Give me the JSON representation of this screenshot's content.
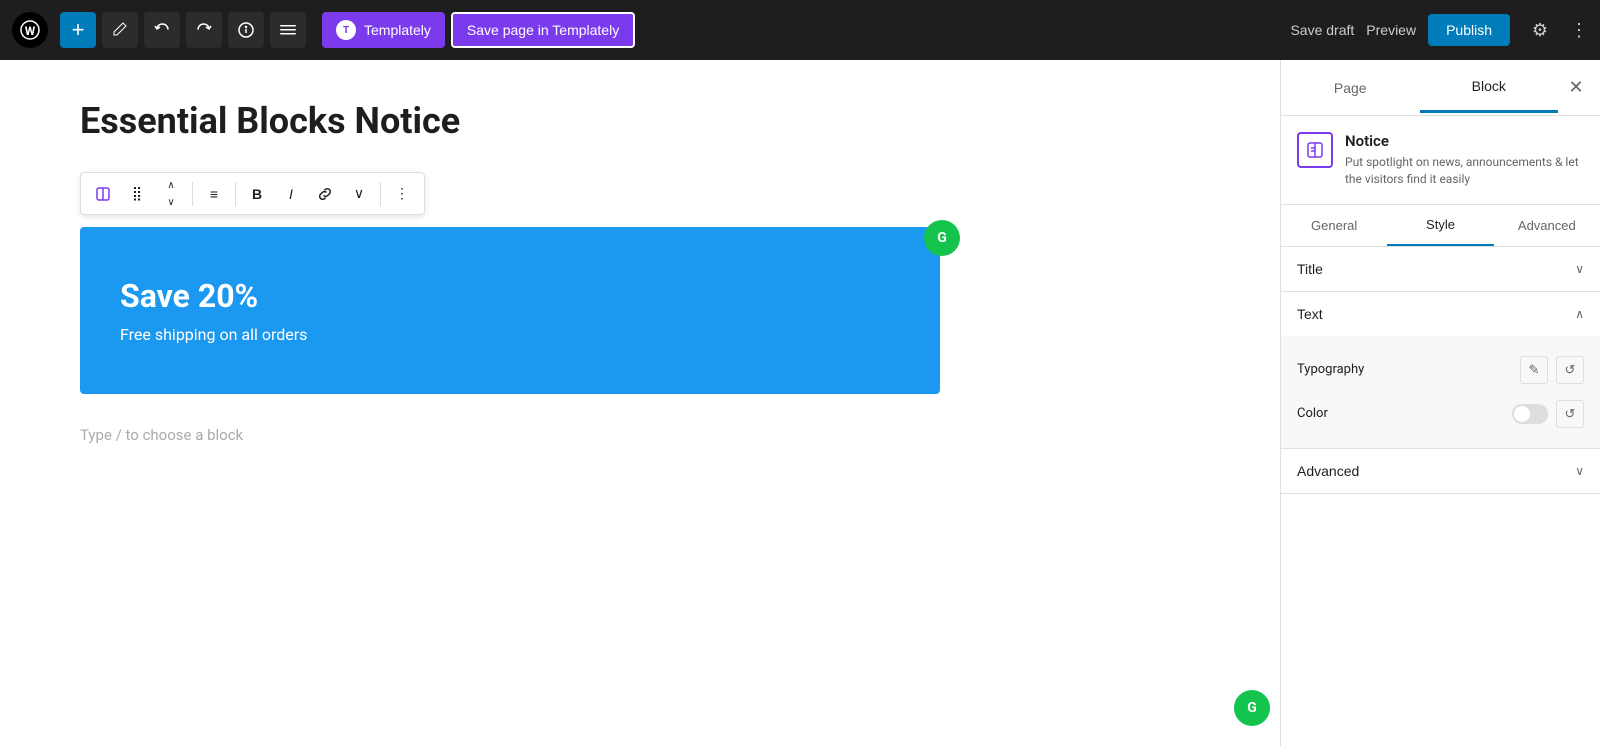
{
  "toolbar": {
    "add_label": "+",
    "undo_label": "↩",
    "redo_label": "↪",
    "info_label": "ℹ",
    "menu_label": "≡",
    "templately_label": "Templately",
    "save_templately_label": "Save page in Templately",
    "save_draft_label": "Save draft",
    "preview_label": "Preview",
    "publish_label": "Publish",
    "settings_label": "⚙",
    "more_label": "⋮"
  },
  "editor": {
    "page_title": "Essential Blocks Notice",
    "type_hint": "Type / to choose a block",
    "notice_block": {
      "title": "Save 20%",
      "subtitle": "Free shipping on all orders"
    }
  },
  "block_toolbar": {
    "icon_label": "📋",
    "drag_label": "⣿",
    "move_up_label": "∧",
    "move_down_label": "∨",
    "align_label": "≡",
    "bold_label": "B",
    "italic_label": "I",
    "link_label": "🔗",
    "more_label": "⋮"
  },
  "sidebar": {
    "tabs": [
      {
        "id": "page",
        "label": "Page"
      },
      {
        "id": "block",
        "label": "Block",
        "active": true
      }
    ],
    "close_label": "✕",
    "block_info": {
      "icon": "📋",
      "name": "Notice",
      "description": "Put spotlight on news, announcements & let the visitors find it easily"
    },
    "style_tabs": [
      {
        "id": "general",
        "label": "General"
      },
      {
        "id": "style",
        "label": "Style",
        "active": true
      },
      {
        "id": "advanced",
        "label": "Advanced"
      }
    ],
    "sections": [
      {
        "id": "title",
        "label": "Title",
        "collapsed": true,
        "rows": []
      },
      {
        "id": "text",
        "label": "Text",
        "collapsed": false,
        "rows": [
          {
            "id": "typography",
            "label": "Typography",
            "type": "edit-reset"
          },
          {
            "id": "color",
            "label": "Color",
            "type": "toggle"
          }
        ]
      },
      {
        "id": "advanced",
        "label": "Advanced",
        "collapsed": true,
        "rows": []
      }
    ]
  },
  "grammarly": {
    "label": "G"
  }
}
